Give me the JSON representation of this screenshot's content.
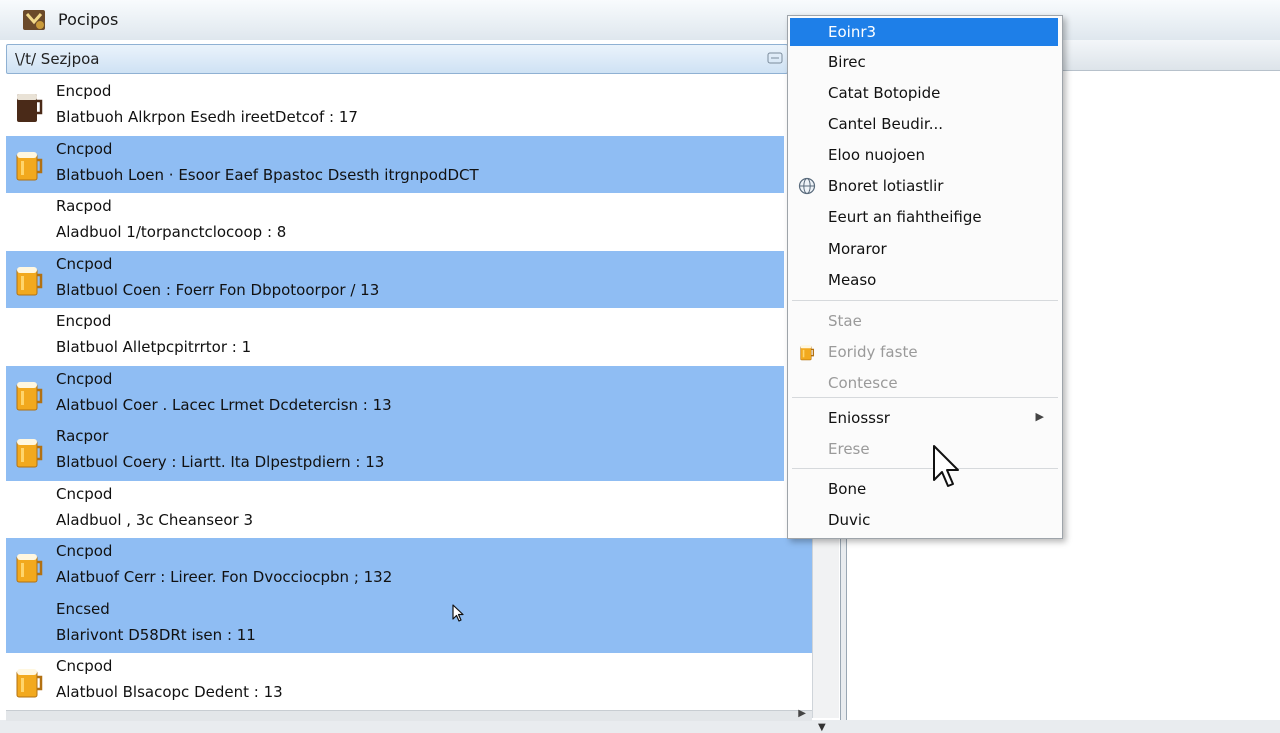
{
  "window": {
    "title": "Pocipos"
  },
  "search": {
    "text": "\\/t/  Sezjpoa"
  },
  "list": {
    "rows": [
      {
        "name": "Encpod",
        "detail": "Blatbuoh  Alkrpon  Esedh ireetDetcof : 17",
        "icon": "dark-mug",
        "selected": false
      },
      {
        "name": "Cncpod",
        "detail": "Blatbuoh  Loen  · Esoor  Eaef Bpastoc  Dsesth itrgnpodDCT",
        "icon": "beer-mug",
        "selected": true
      },
      {
        "name": "Racpod",
        "detail": "Aladbuol  1/torpanctclocoop : 8",
        "icon": "none",
        "selected": false
      },
      {
        "name": "Cncpod",
        "detail": "Blatbuol  Coen : Foerr  Fon Dbpotoorpor  /  13",
        "icon": "beer-mug",
        "selected": true
      },
      {
        "name": "Encpod",
        "detail": "Blatbuol  Alletpcpitrrtor : 1",
        "icon": "none",
        "selected": false
      },
      {
        "name": "Cncpod",
        "detail": "Alatbuol  Coer  . Lacec  Lrmet Dcdetercisn : 13",
        "icon": "beer-mug",
        "selected": true
      },
      {
        "name": "Racpor",
        "detail": "Blatbuol  Coery : Liartt.  Ita  Dlpestpdiern : 13",
        "icon": "beer-mug",
        "selected": true
      },
      {
        "name": "Cncpod",
        "detail": "Aladbuol , 3c  Cheanseor  3",
        "icon": "none",
        "selected": false
      },
      {
        "name": "Cncpod",
        "detail": "Alatbuof  Cerr : Lireer.  Fon Dvocciocpbn ; 132",
        "icon": "beer-mug",
        "selected": true
      },
      {
        "name": "Encsed",
        "detail": "Blarivont  D58DRt isen : 11",
        "icon": "none",
        "selected": true
      },
      {
        "name": "Cncpod",
        "detail": "Alatbuol  Blsacopc Dedent : 13",
        "icon": "beer-mug",
        "selected": false
      }
    ]
  },
  "context_menu": {
    "items": [
      {
        "label": "Eoinr3",
        "state": "active",
        "icon": ""
      },
      {
        "label": "Birec",
        "state": "normal",
        "icon": ""
      },
      {
        "label": "Catat  Botopide",
        "state": "normal",
        "icon": ""
      },
      {
        "label": "Cantel  Beudir...",
        "state": "normal",
        "icon": ""
      },
      {
        "label": "Eloo  nuojoen",
        "state": "normal",
        "icon": ""
      },
      {
        "label": "Bnoret  lotiastlir",
        "state": "normal",
        "icon": "globe-icon"
      },
      {
        "label": "Eeurt  an  fiahtheifige",
        "state": "normal",
        "icon": ""
      },
      {
        "label": "Moraror",
        "state": "normal",
        "icon": ""
      },
      {
        "label": "Measo",
        "state": "normal",
        "icon": ""
      },
      {
        "label": "Stae",
        "state": "disabled",
        "icon": ""
      },
      {
        "label": "Eoridy  faste",
        "state": "disabled",
        "icon": "beer-mug"
      },
      {
        "label": "Contesce",
        "state": "disabled",
        "icon": ""
      },
      {
        "label": "Eniosssr",
        "state": "normal",
        "icon": "",
        "submenu": true
      },
      {
        "label": "Erese",
        "state": "disabled",
        "icon": ""
      },
      {
        "label": "Bone",
        "state": "normal",
        "icon": ""
      },
      {
        "label": "Duvic",
        "state": "normal",
        "icon": ""
      }
    ]
  },
  "colors": {
    "selection": "#8fbdf3",
    "menu_active": "#1e7fe8",
    "disabled_text": "#9a9a9a"
  }
}
